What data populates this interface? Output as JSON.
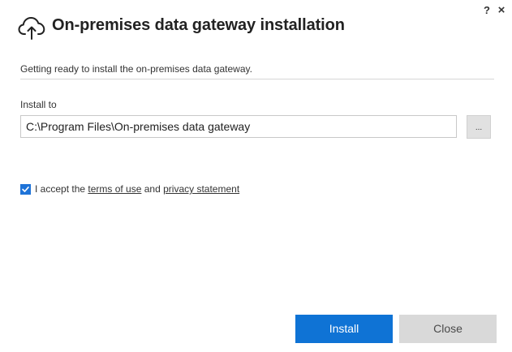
{
  "window": {
    "help_label": "?",
    "close_label": "×"
  },
  "header": {
    "icon": "cloud-upload-icon",
    "title": "On-premises data gateway installation"
  },
  "status": {
    "text": "Getting ready to install the on-premises data gateway."
  },
  "install": {
    "label": "Install to",
    "path_value": "C:\\Program Files\\On-premises data gateway",
    "browse_label": "..."
  },
  "terms": {
    "checked": true,
    "prefix": "I accept the ",
    "terms_link": "terms of use",
    "middle": " and ",
    "privacy_link": "privacy statement"
  },
  "buttons": {
    "install_label": "Install",
    "close_label": "Close"
  },
  "colors": {
    "accent": "#0f73d5",
    "checkbox": "#1e73d8",
    "secondary_button": "#d9d9d9"
  }
}
